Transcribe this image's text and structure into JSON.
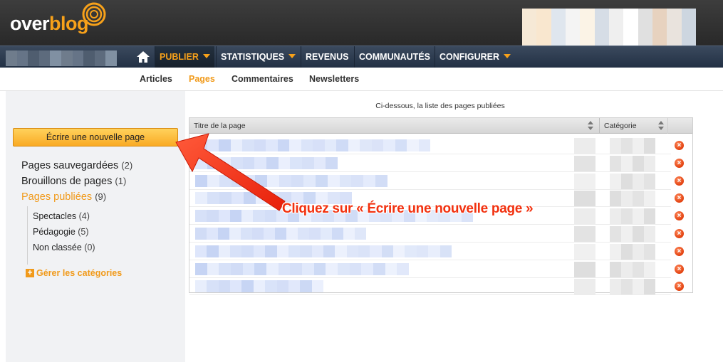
{
  "brand": {
    "part1": "over",
    "part2": "blog"
  },
  "nav": {
    "items": [
      {
        "label": "PUBLIER",
        "dropdown": true,
        "active": true
      },
      {
        "label": "STATISTIQUES",
        "dropdown": true
      },
      {
        "label": "REVENUS",
        "dropdown": false
      },
      {
        "label": "COMMUNAUTÉS",
        "dropdown": false
      },
      {
        "label": "CONFIGURER",
        "dropdown": true
      }
    ]
  },
  "subnav": [
    "Articles",
    "Pages",
    "Commentaires",
    "Newsletters"
  ],
  "sidebar": {
    "write_button": "Écrire une nouvelle page",
    "links": [
      {
        "label": "Pages sauvegardées",
        "count": "(2)"
      },
      {
        "label": "Brouillons de pages",
        "count": "(1)"
      },
      {
        "label": "Pages publiées",
        "count": "(9)"
      }
    ],
    "categories": [
      {
        "label": "Spectacles",
        "count": "(4)"
      },
      {
        "label": "Pédagogie",
        "count": "(5)"
      },
      {
        "label": "Non classée",
        "count": "(0)"
      }
    ],
    "manage": "Gérer les catégories"
  },
  "main": {
    "intro": "Ci-dessous, la liste des pages publiées",
    "columns": [
      "Titre de la page",
      "Catégorie"
    ]
  },
  "annotation": "Cliquez sur « Écrire une nouvelle page »",
  "colors": {
    "accent": "#f7a11a",
    "annotation": "#f2310f",
    "navbar": "#2a3a4f"
  }
}
